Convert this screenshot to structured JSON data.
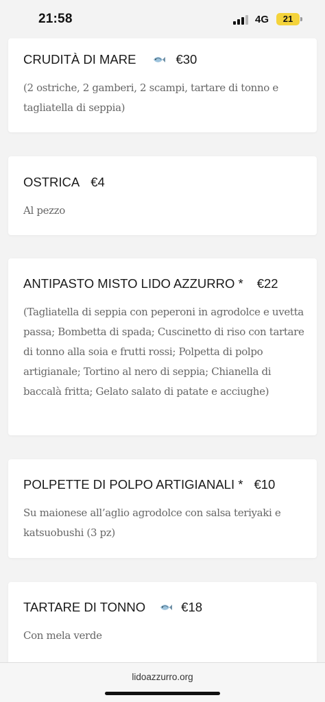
{
  "status_bar": {
    "time": "21:58",
    "network": "4G",
    "battery": "21",
    "battery_color": "#f4d33b"
  },
  "menu": {
    "items": [
      {
        "name": "CRUDITÀ DI MARE",
        "icon": "fish-icon",
        "price": "€30",
        "description": "(2 ostriche, 2 gamberi, 2 scampi, tartare di tonno e tagliatella di seppia)"
      },
      {
        "name": "OSTRICA",
        "price": "€4",
        "description": "Al pezzo"
      },
      {
        "name": "ANTIPASTO MISTO LIDO AZZURRO *",
        "price": "€22",
        "description": "(Tagliatella di seppia con peperoni in agrodolce e uvetta passa; Bombetta di spada; Cuscinetto di riso con tartare di tonno alla soia e frutti rossi; Polpetta di polpo artigianale; Tortino al nero di seppia; Chianella di baccalà fritta; Gelato salato di patate e acciughe)"
      },
      {
        "name": "POLPETTE DI POLPO ARTIGIANALI *",
        "price": "€10",
        "description": "Su maionese all’aglio agrodolce con salsa teriyaki e katsuobushi (3 pz)"
      },
      {
        "name": "TARTARE DI TONNO",
        "icon": "fish-icon",
        "price": "€18",
        "description": "Con mela verde"
      }
    ]
  },
  "browser": {
    "url": "lidoazzurro.org"
  }
}
